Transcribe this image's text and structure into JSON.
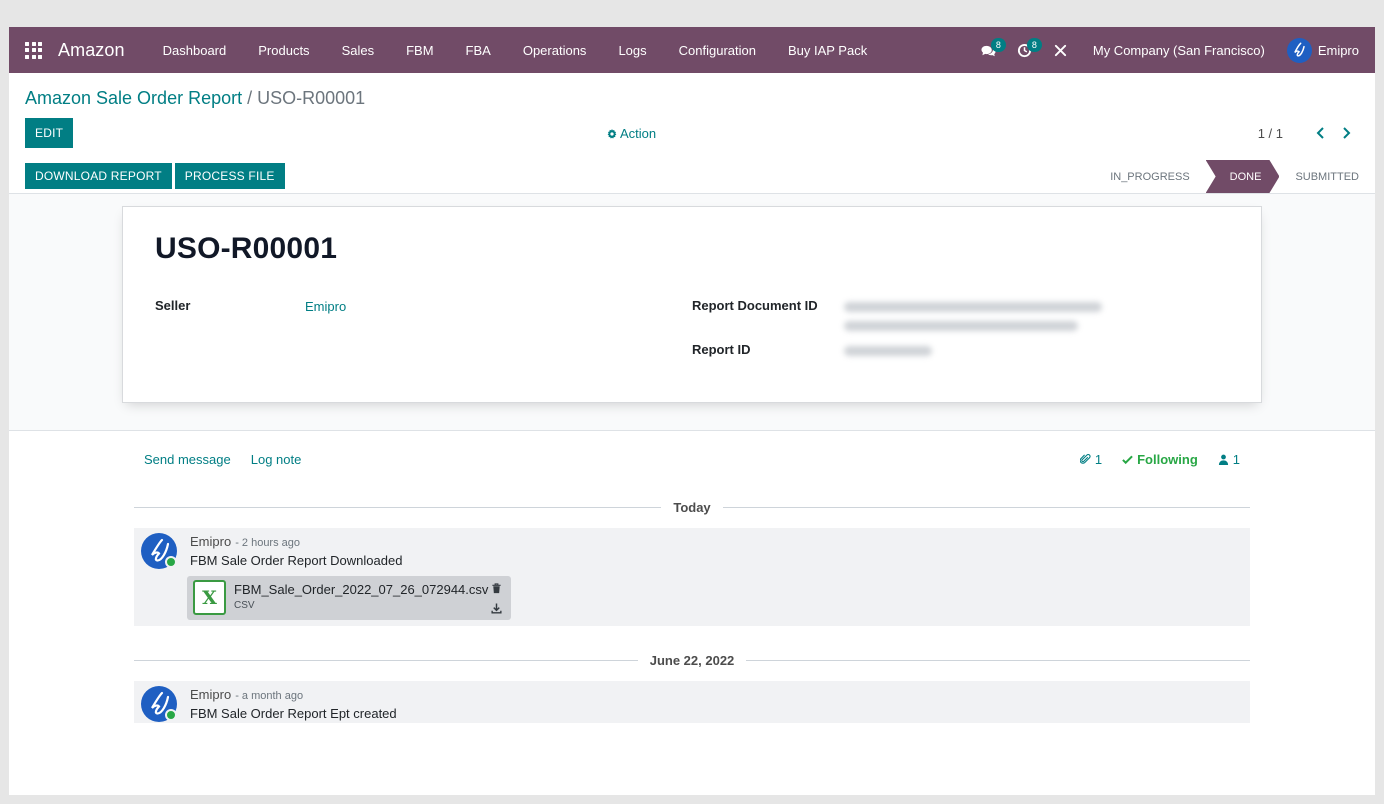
{
  "navbar": {
    "brand": "Amazon",
    "menu": [
      "Dashboard",
      "Products",
      "Sales",
      "FBM",
      "FBA",
      "Operations",
      "Logs",
      "Configuration",
      "Buy IAP Pack"
    ],
    "messages_count": "8",
    "activities_count": "8",
    "company": "My Company (San Francisco)",
    "user": "Emipro"
  },
  "control": {
    "breadcrumb_parent": "Amazon Sale Order Report",
    "breadcrumb_sep": "/",
    "breadcrumb_current": "USO-R00001",
    "edit_label": "EDIT",
    "action_label": "Action",
    "pager": "1 / 1"
  },
  "statusbar": {
    "download_label": "DOWNLOAD REPORT",
    "process_label": "PROCESS FILE",
    "stages": [
      "IN_PROGRESS",
      "DONE",
      "SUBMITTED"
    ],
    "active_stage": "DONE"
  },
  "form": {
    "title": "USO-R00001",
    "seller_label": "Seller",
    "seller_value": "Emipro",
    "report_document_id_label": "Report Document ID",
    "report_id_label": "Report ID"
  },
  "chatter": {
    "send_message": "Send message",
    "log_note": "Log note",
    "attachments_count": "1",
    "following_label": "Following",
    "followers_count": "1",
    "messages": [
      {
        "date": "Today",
        "author": "Emipro",
        "when": "- 2 hours ago",
        "body": "FBM Sale Order Report Downloaded",
        "attachment": {
          "name": "FBM_Sale_Order_2022_07_26_072944.csv",
          "ext": "csv"
        }
      },
      {
        "date": "June 22, 2022",
        "author": "Emipro",
        "when": "- a month ago",
        "body": "FBM Sale Order Report Ept created"
      }
    ]
  },
  "colors": {
    "brand": "#714b67",
    "primary": "#017e84",
    "success": "#28a745"
  }
}
